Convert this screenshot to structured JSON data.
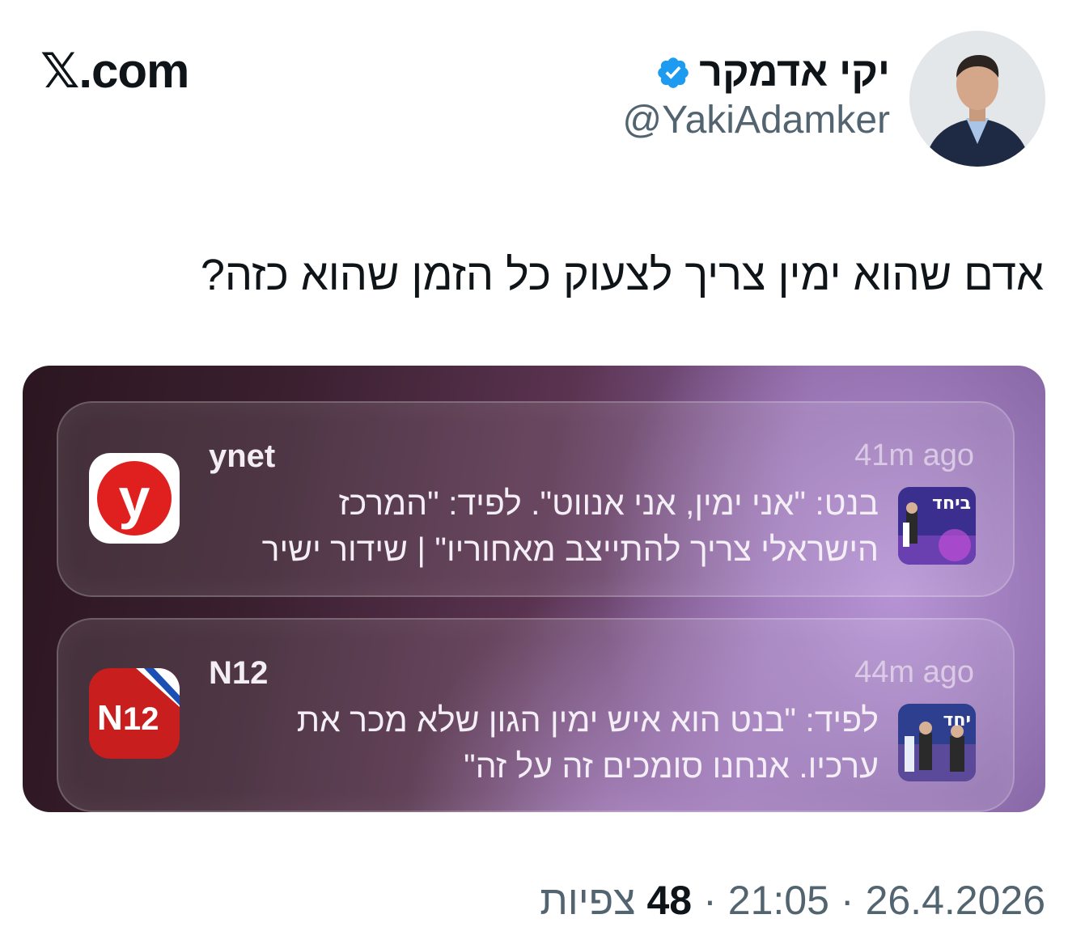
{
  "brand": {
    "x": "𝕏",
    "rest": ".com"
  },
  "author": {
    "name": "יקי אדמקר",
    "handle": "@YakiAdamker",
    "verified_icon": "verified-badge-icon",
    "verified_color": "#1d9bf0"
  },
  "tweet": {
    "text": "אדם שהוא ימין צריך לצעוק כל הזמן שהוא כזה?"
  },
  "notifications": [
    {
      "app": "ynet",
      "time": "41m ago",
      "body_line1": "בנט: \"אני ימין, אני אנווט\". לפיד: \"המרכז",
      "body_line2": "הישראלי צריך להתייצב מאחוריו\" | שידור ישיר",
      "icon_letter": "y",
      "icon_color": "#e0201f",
      "thumb_text": "ביחד"
    },
    {
      "app": "N12",
      "time": "44m ago",
      "body_line1": "לפיד: \"בנט הוא איש ימין הגון שלא מכר את",
      "body_line2": "ערכיו. אנחנו סומכים זה על זה\"",
      "icon_text_n": "N",
      "icon_text_num": "12",
      "icon_color": "#c81e1e",
      "thumb_text": "יחד"
    }
  ],
  "meta": {
    "date": "26.4.2026",
    "time": "21:05",
    "sep": "·",
    "views_count": "48",
    "views_label": "צפיות"
  }
}
